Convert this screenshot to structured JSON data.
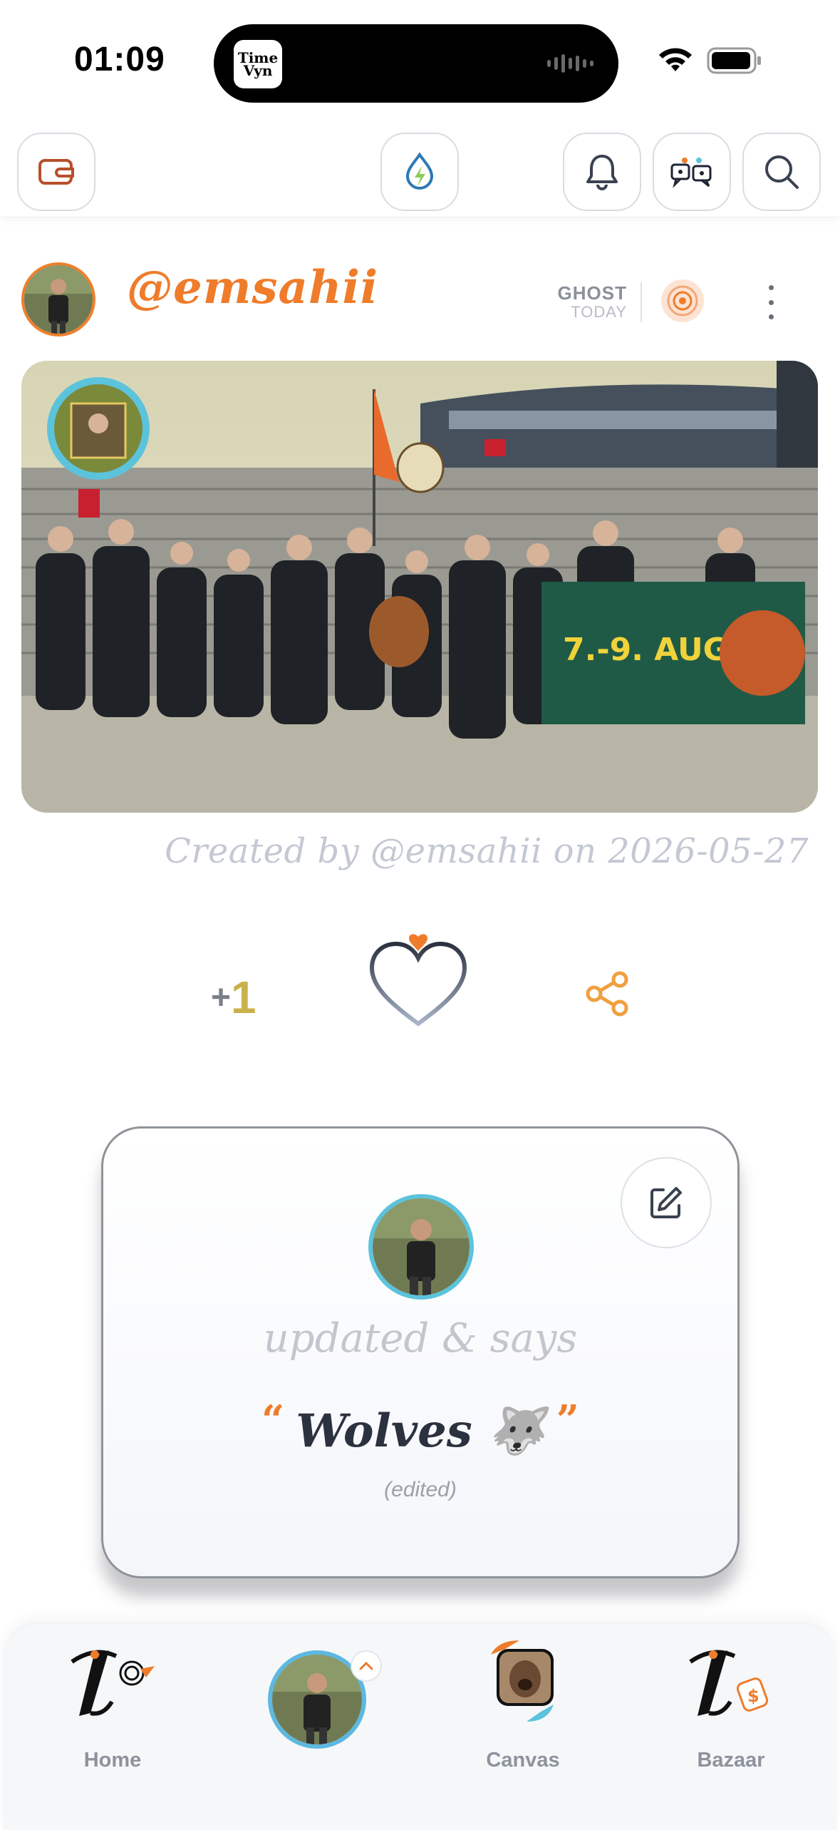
{
  "status_bar": {
    "time": "01:09",
    "island_app": "Time Vyn"
  },
  "top_nav": {
    "icons": [
      "wallet-icon",
      "drop-bolt-icon",
      "bell-icon",
      "chat-icon",
      "search-icon"
    ]
  },
  "post": {
    "username": "@emsahii",
    "visibility": "GHOST",
    "time_label": "TODAY",
    "created_caption": "Created by @emsahii on 2026-05-27",
    "plus_sign": "+",
    "plus_count": "1"
  },
  "update_card": {
    "says_label": "updated & says",
    "open_quote": "“",
    "message": "Wolves 🐺",
    "close_quote": "”",
    "edited_label": "(edited)"
  },
  "tab_bar": {
    "items": [
      {
        "label": "Home"
      },
      {
        "label": ""
      },
      {
        "label": "Canvas"
      },
      {
        "label": "Bazaar"
      }
    ]
  },
  "colors": {
    "accent_orange": "#ef7c2a",
    "ring_cyan": "#5cc3dc",
    "text_dark": "#2c3140",
    "muted_gray": "#8d939d"
  }
}
